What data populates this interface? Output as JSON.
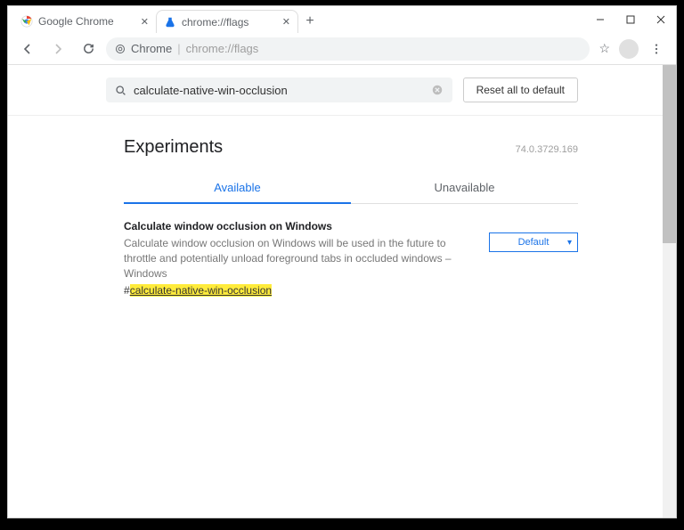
{
  "window": {
    "tabs": [
      {
        "title": "Google Chrome",
        "active": false
      },
      {
        "title": "chrome://flags",
        "active": true
      }
    ]
  },
  "omnibox": {
    "scheme_label": "Chrome",
    "path": "chrome://flags"
  },
  "search": {
    "value": "calculate-native-win-occlusion",
    "reset_label": "Reset all to default"
  },
  "experiments": {
    "heading": "Experiments",
    "version": "74.0.3729.169",
    "tabs": {
      "available": "Available",
      "unavailable": "Unavailable"
    }
  },
  "flag": {
    "title": "Calculate window occlusion on Windows",
    "description": "Calculate window occlusion on Windows will be used in the future to throttle and potentially unload foreground tabs in occluded windows – Windows",
    "hash_prefix": "#",
    "hash": "calculate-native-win-occlusion",
    "select_value": "Default"
  }
}
